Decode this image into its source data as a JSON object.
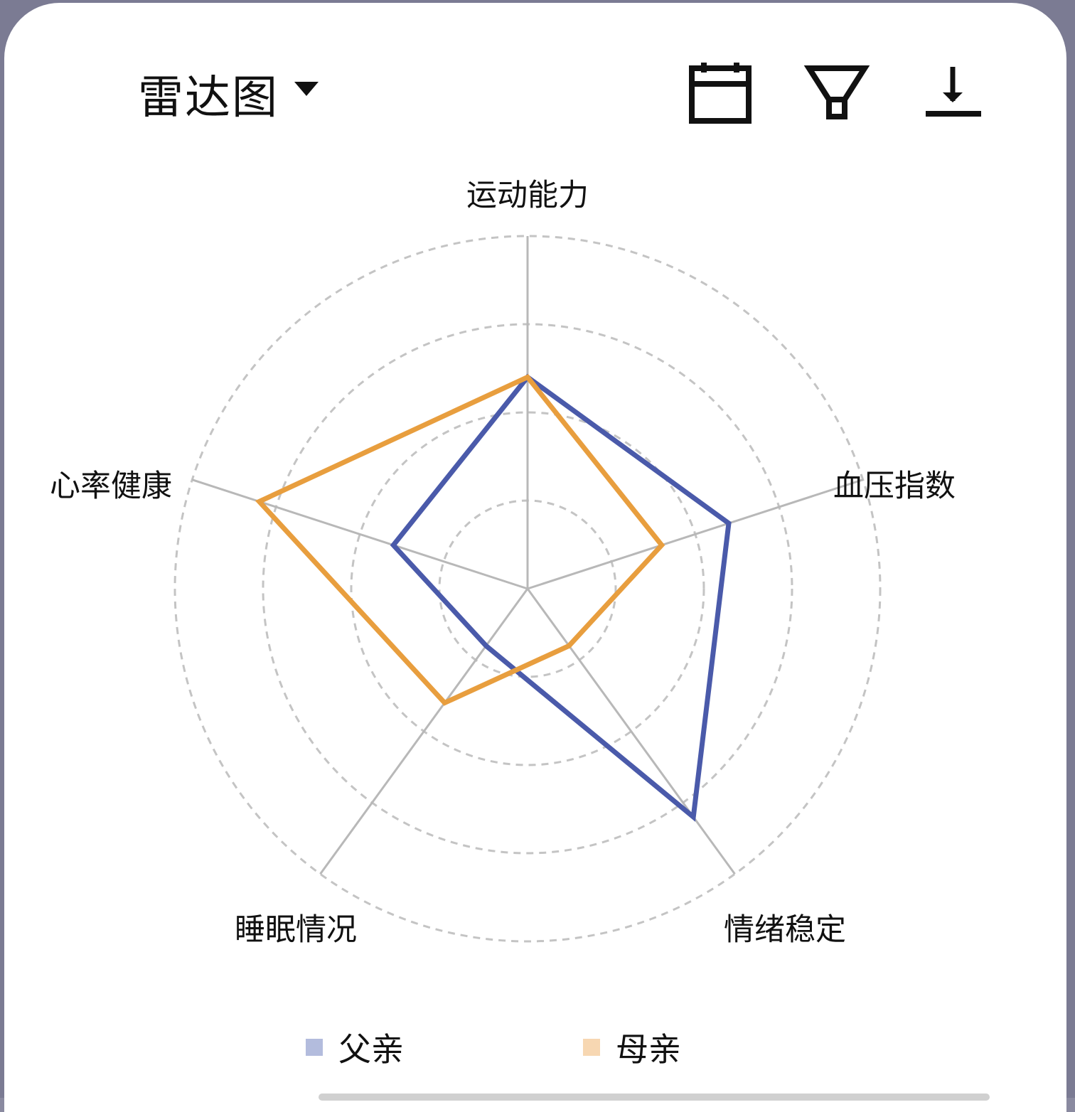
{
  "header": {
    "chart_type_label": "雷达图",
    "icons": [
      "calendar-icon",
      "filter-icon",
      "download-icon"
    ]
  },
  "colors": {
    "father": "#4a5aaa",
    "mother": "#e89e3e",
    "father_legend": "#b3bcdd",
    "mother_legend": "#f7d7b2",
    "axis": "#b8b8b8",
    "grid": "#c4c4c4"
  },
  "legend": [
    {
      "label": "父亲"
    },
    {
      "label": "母亲"
    }
  ],
  "chart_data": {
    "type": "radar",
    "indicators": [
      "运动能力",
      "血压指数",
      "情绪稳定",
      "睡眠情况",
      "心率健康"
    ],
    "max": 5,
    "rings": 4,
    "grid": true,
    "grid_style": "dashed",
    "legend_position": "bottom",
    "series": [
      {
        "name": "父亲",
        "values": [
          3.0,
          3.0,
          4.0,
          1.0,
          2.0
        ]
      },
      {
        "name": "母亲",
        "values": [
          3.0,
          2.0,
          1.0,
          2.0,
          4.0
        ]
      }
    ]
  }
}
